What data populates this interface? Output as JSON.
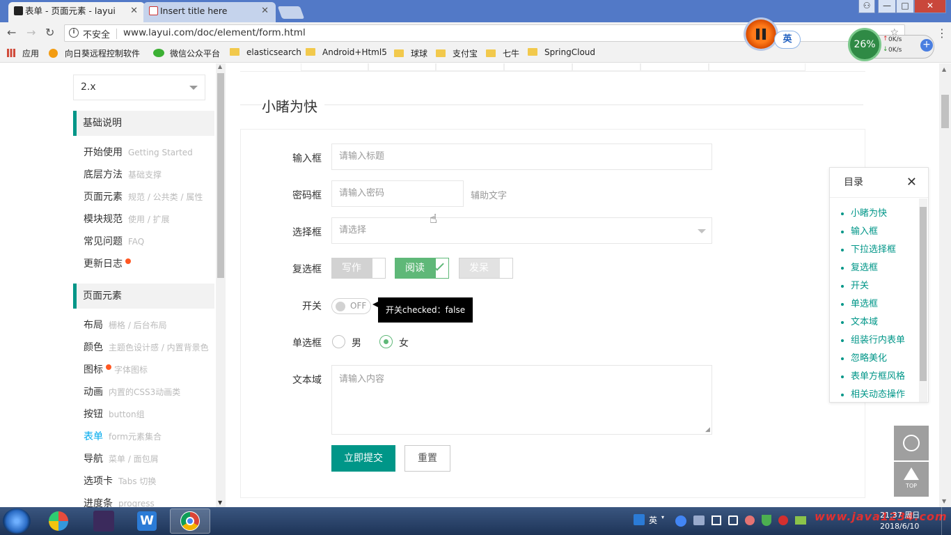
{
  "browser": {
    "tabs": [
      {
        "title": "表单 - 页面元素 - layui",
        "active": true
      },
      {
        "title": "Insert title here",
        "active": false
      }
    ],
    "insecure_label": "不安全",
    "url": "www.layui.com/doc/element/form.html",
    "bookmarks": [
      "应用",
      "向日葵远程控制软件",
      "微信公众平台",
      "elasticsearch",
      "Android+Html5",
      "球球",
      "支付宝",
      "七牛",
      "SpringCloud"
    ],
    "ime_label": "英",
    "speed": {
      "percent": "26%",
      "up": "0K/s",
      "down": "0K/s"
    }
  },
  "sidebar": {
    "version": "2.x",
    "section1": {
      "title": "基础说明",
      "items": [
        {
          "label": "开始使用",
          "sub": "Getting Started"
        },
        {
          "label": "底层方法",
          "sub": "基础支撑"
        },
        {
          "label": "页面元素",
          "sub": "规范 / 公共类 / 属性"
        },
        {
          "label": "模块规范",
          "sub": "使用 / 扩展"
        },
        {
          "label": "常见问题",
          "sub": "FAQ"
        },
        {
          "label": "更新日志",
          "sub": ""
        }
      ]
    },
    "section2": {
      "title": "页面元素",
      "items": [
        {
          "label": "布局",
          "sub": "栅格 / 后台布局"
        },
        {
          "label": "颜色",
          "sub": "主题色设计感 / 内置背景色"
        },
        {
          "label": "图标",
          "sub": "字体图标"
        },
        {
          "label": "动画",
          "sub": "内置的CSS3动画类"
        },
        {
          "label": "按钮",
          "sub": "button组"
        },
        {
          "label": "表单",
          "sub": "form元素集合"
        },
        {
          "label": "导航",
          "sub": "菜单 / 面包屑"
        },
        {
          "label": "选项卡",
          "sub": "Tabs 切换"
        },
        {
          "label": "进度条",
          "sub": "progress"
        }
      ]
    }
  },
  "content": {
    "section_title": "小睹为快",
    "form": {
      "input_label": "输入框",
      "input_placeholder": "请输入标题",
      "password_label": "密码框",
      "password_placeholder": "请输入密码",
      "password_aux": "辅助文字",
      "select_label": "选择框",
      "select_placeholder": "请选择",
      "checkbox_label": "复选框",
      "checkboxes": [
        {
          "text": "写作",
          "state": "unchecked"
        },
        {
          "text": "阅读",
          "state": "checked"
        },
        {
          "text": "发呆",
          "state": "disabled"
        }
      ],
      "switch_label": "开关",
      "switch_text": "OFF",
      "switch_tooltip": "开关checked：false",
      "radio_label": "单选框",
      "radios": [
        {
          "text": "男",
          "checked": false
        },
        {
          "text": "女",
          "checked": true
        }
      ],
      "textarea_label": "文本域",
      "textarea_placeholder": "请输入内容",
      "submit_label": "立即提交",
      "reset_label": "重置"
    }
  },
  "toc": {
    "title": "目录",
    "items": [
      "小睹为快",
      "输入框",
      "下拉选择框",
      "复选框",
      "开关",
      "单选框",
      "文本域",
      "组装行内表单",
      "忽略美化",
      "表单方框风格",
      "相关动态操作"
    ]
  },
  "fixbar": {
    "top_label": "TOP"
  },
  "taskbar": {
    "ime": "英",
    "time": "21:37 周日",
    "date": "2018/6/10",
    "watermark": "www.java1234.com"
  }
}
